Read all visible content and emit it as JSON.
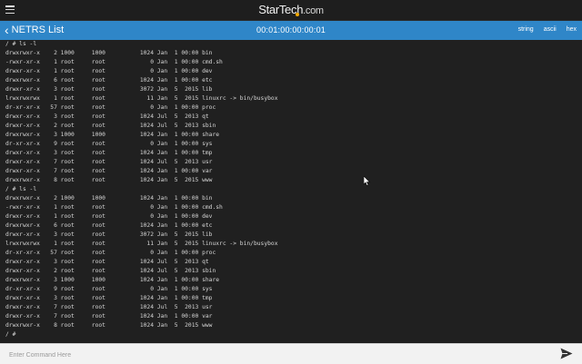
{
  "app": {
    "brand": "StarTech",
    "brand_suffix": ".com",
    "accent_color": "#2f86c8",
    "brand_dot_color": "#f5a800"
  },
  "header": {
    "back_label": "NETRS List",
    "device_id": "00:01:00:00:00:01",
    "modes": [
      "string",
      "ascii",
      "hex"
    ]
  },
  "terminal": {
    "lines": [
      "/ # ls -l",
      "drwxrwxr-x    2 1000     1000          1024 Jan  1 00:00 bin",
      "-rwxr-xr-x    1 root     root             0 Jan  1 00:00 cmd.sh",
      "drwxr-xr-x    1 root     root             0 Jan  1 00:00 dev",
      "drwxrwxr-x    6 root     root          1024 Jan  1 00:00 etc",
      "drwxr-xr-x    3 root     root          3072 Jan  5  2015 lib",
      "lrwxrwxrwx    1 root     root            11 Jan  5  2015 linuxrc -> bin/busybox",
      "dr-xr-xr-x   57 root     root             0 Jan  1 00:00 proc",
      "drwxr-xr-x    3 root     root          1024 Jul  5  2013 qt",
      "drwxr-xr-x    2 root     root          1024 Jul  5  2013 sbin",
      "drwxrwxr-x    3 1000     1000          1024 Jan  1 00:00 share",
      "dr-xr-xr-x    9 root     root             0 Jan  1 00:00 sys",
      "drwxr-xr-x    3 root     root          1024 Jan  1 00:00 tmp",
      "drwxr-xr-x    7 root     root          1024 Jul  5  2013 usr",
      "drwxr-xr-x    7 root     root          1024 Jan  1 00:00 var",
      "drwxrwxr-x    8 root     root          1024 Jan  5  2015 www",
      "/ # ls -l",
      "drwxrwxr-x    2 1000     1000          1024 Jan  1 00:00 bin",
      "-rwxr-xr-x    1 root     root             0 Jan  1 00:00 cmd.sh",
      "drwxr-xr-x    1 root     root             0 Jan  1 00:00 dev",
      "drwxrwxr-x    6 root     root          1024 Jan  1 00:00 etc",
      "drwxr-xr-x    3 root     root          3072 Jan  5  2015 lib",
      "lrwxrwxrwx    1 root     root            11 Jan  5  2015 linuxrc -> bin/busybox",
      "dr-xr-xr-x   57 root     root             0 Jan  1 00:00 proc",
      "drwxr-xr-x    3 root     root          1024 Jul  5  2013 qt",
      "drwxr-xr-x    2 root     root          1024 Jul  5  2013 sbin",
      "drwxrwxr-x    3 1000     1000          1024 Jan  1 00:00 share",
      "dr-xr-xr-x    9 root     root             0 Jan  1 00:00 sys",
      "drwxr-xr-x    3 root     root          1024 Jan  1 00:00 tmp",
      "drwxr-xr-x    7 root     root          1024 Jul  5  2013 usr",
      "drwxr-xr-x    7 root     root          1024 Jan  1 00:00 var",
      "drwxrwxr-x    8 root     root          1024 Jan  5  2015 www",
      "/ #"
    ]
  },
  "command": {
    "placeholder": "Enter Command Here",
    "value": ""
  }
}
